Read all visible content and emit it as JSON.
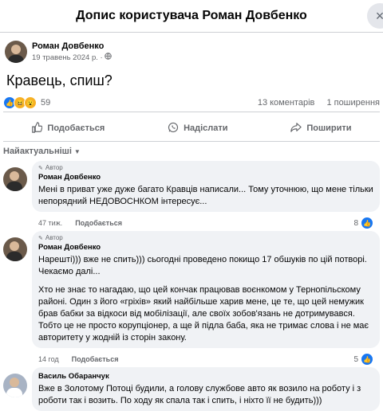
{
  "header": {
    "title": "Допис користувача Роман Довбенко",
    "close_icon": "×"
  },
  "post": {
    "author": "Роман Довбенко",
    "date": "19 травень 2024 р.",
    "separator": "·",
    "text": "Кравець, спиш?",
    "reaction_count": "59",
    "comments_count": "13 коментарів",
    "shares_count": "1 поширення"
  },
  "actions": {
    "like": "Подобається",
    "send": "Надіслати",
    "share": "Поширити"
  },
  "sort": {
    "label": "Найактуальніші"
  },
  "comments": [
    {
      "badge": "Автор",
      "name": "Роман Довбенко",
      "paragraphs": [
        "Мені в приват уже дуже багато Кравців написали... Тому уточнюю, що мене тільки непорядний НЕДОВОСНКОМ інтересує..."
      ],
      "time": "47 тиж.",
      "like": "Подобається",
      "reacts": "8"
    },
    {
      "badge": "Автор",
      "name": "Роман Довбенко",
      "paragraphs": [
        "Нарешті))) вже не спить))) сьогодні проведено покищо 17 обшуків по цій потворі. Чекаємо далі...",
        "Хто не знає то нагадаю, що цей кончак працював воєнкомом у Тернопільскому районі. Один з його «гріхів» який найбільше харив мене, це те, що цей немужик брав бабки за відкоси від мобілізації, але своїх зобов'язань не дотримувався. Тобто це не просто корупціонер, а ще й підла баба, яка не тримає слова і не має авторитету у жодній із сторін закону."
      ],
      "time": "14 год",
      "like": "Подобається",
      "reacts": "5"
    },
    {
      "name": "Василь Обаранчук",
      "paragraphs": [
        "Вже в Золотому Потоці будили, а голову службове авто як возило на роботу і з роботи так і возить. По ходу як спала так і спить, і ніхто її не будить)))"
      ]
    }
  ]
}
